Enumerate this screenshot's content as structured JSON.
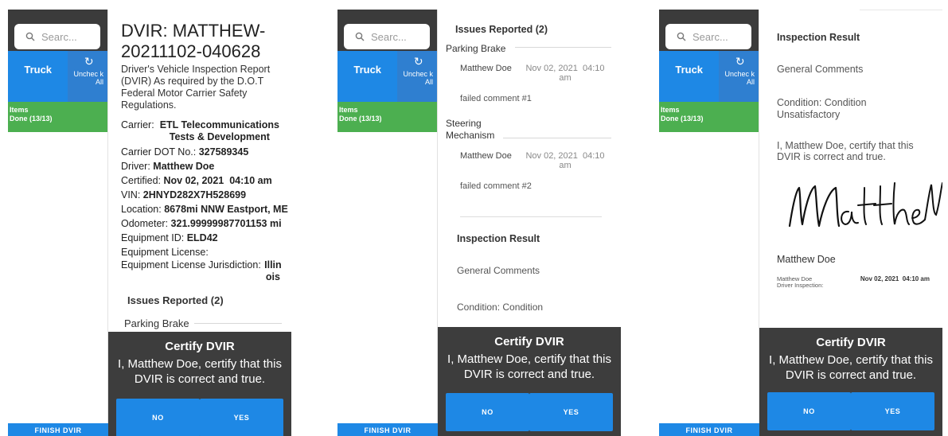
{
  "app": {
    "search_placeholder": "Searc...",
    "truck_tab": "Truck",
    "uncheck_all": "Unchec k All",
    "items_label": "Items",
    "items_done": "Done (13/13)",
    "finish_dvir": "FINISH DVIR",
    "accent_color": "#1e88e5",
    "items_color": "#4caf50",
    "header_color": "#3b3b3b"
  },
  "panel1": {
    "title": "DVIR: MATTHEW-20211102-040628",
    "subtitle": "Driver's Vehicle Inspection Report (DVIR) As required by the D.O.T Federal Motor Carrier Safety Regulations.",
    "carrier_label": "Carrier:",
    "carrier_value": "ETL Telecommunications Tests & Development",
    "dot_label": "Carrier DOT No.:",
    "dot_value": "327589345",
    "driver_label": "Driver:",
    "driver_value": "Matthew Doe",
    "certified_label": "Certified:",
    "certified_value": "Nov 02, 2021  04:10 am",
    "vin_label": "VIN:",
    "vin_value": "2HNYD282X7H528699",
    "location_label": "Location:",
    "location_value": "8678mi NNW Eastport, ME",
    "odometer_label": "Odometer:",
    "odometer_value": "321.99999987701153 mi",
    "equipment_id_label": "Equipment ID:",
    "equipment_id_value": "ELD42",
    "equipment_license_label": "Equipment License:",
    "jurisdiction_label": "Equipment License Jurisdiction:",
    "jurisdiction_value": "Illinois",
    "issues_reported": "Issues Reported (2)",
    "first_issue": "Parking Brake"
  },
  "panel2": {
    "issues_reported": "Issues Reported (2)",
    "issues": [
      {
        "title": "Parking Brake",
        "driver": "Matthew Doe",
        "date": "Nov 02, 2021  04:10 am",
        "comment": "failed comment #1"
      },
      {
        "title": "Steering Mechanism",
        "driver": "Matthew Doe",
        "date": "Nov 02, 2021  04:10 am",
        "comment": "failed comment #2"
      }
    ],
    "inspection_result": "Inspection Result",
    "general_comments": "General Comments",
    "condition": "Condition: Condition"
  },
  "panel3": {
    "inspection_result": "Inspection Result",
    "general_comments": "General Comments",
    "condition": "Condition: Condition Unsatisfactory",
    "certify_text": "I, Matthew Doe, certify that this DVIR is correct and true.",
    "signature_name": "Matthew Doe",
    "footer_name": "Matthew Doe",
    "footer_role": "Driver Inspection:",
    "footer_date": "Nov 02, 2021  04:10 am"
  },
  "certify": {
    "title": "Certify DVIR",
    "body": "I, Matthew Doe, certify that this DVIR is correct and true.",
    "no_label": "NO",
    "yes_label": "YES"
  }
}
